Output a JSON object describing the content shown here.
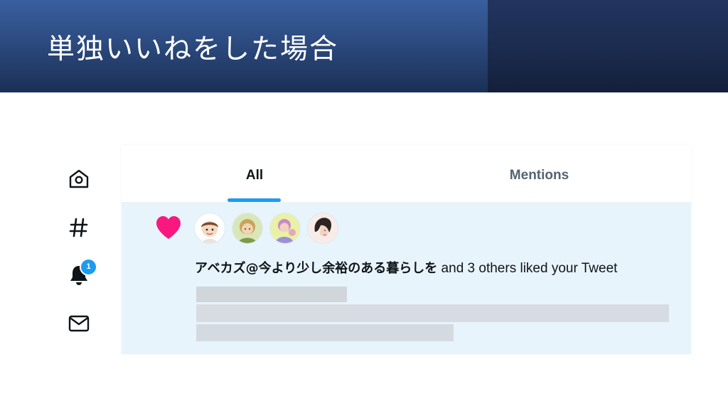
{
  "slide": {
    "title": "単独いいねをした場合"
  },
  "sidebar": {
    "items": [
      {
        "icon": "home-icon"
      },
      {
        "icon": "hashtag-icon"
      },
      {
        "icon": "bell-icon",
        "badge": "1"
      },
      {
        "icon": "mail-icon"
      }
    ]
  },
  "tabs": {
    "all_label": "All",
    "mentions_label": "Mentions",
    "active": "All"
  },
  "notification": {
    "icon": "heart-icon",
    "user_name": "アベカズ@今より少し余裕のある暮らしを",
    "action_text": " and 3 others liked your Tweet",
    "avatar_count": 4
  },
  "colors": {
    "accent": "#1d9bf0",
    "heart": "#f91880",
    "notification_bg": "#e8f4fc"
  }
}
